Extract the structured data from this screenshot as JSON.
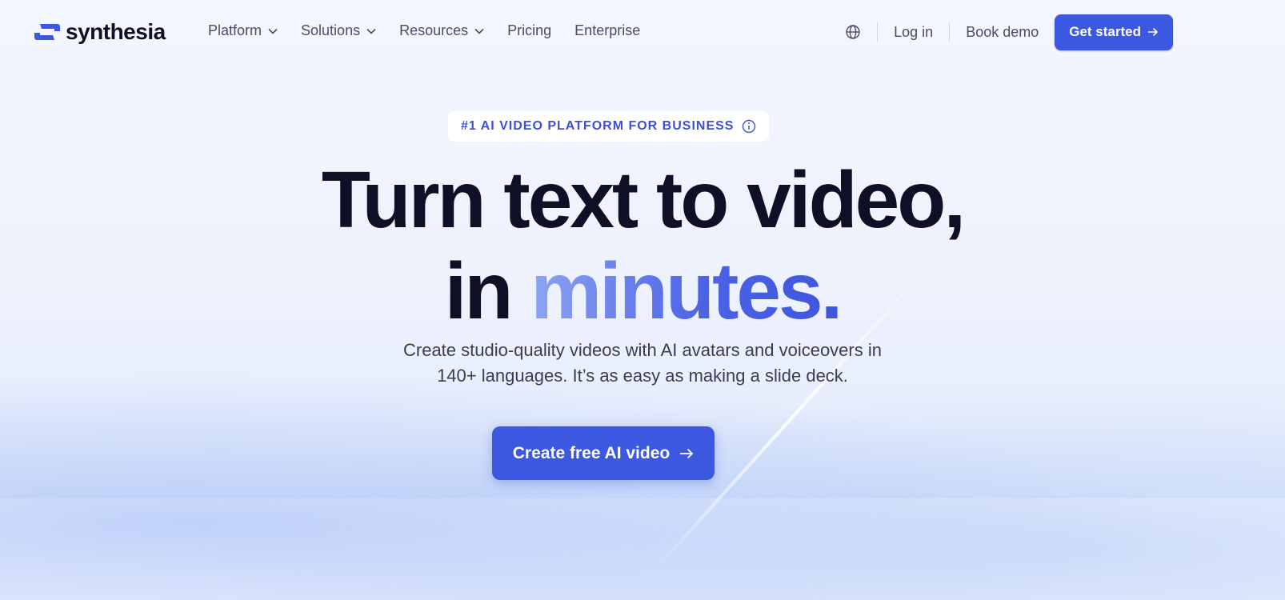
{
  "brand": {
    "name": "synthesia",
    "color": "#3d58e0"
  },
  "nav": {
    "items": [
      {
        "label": "Platform",
        "has_dropdown": true
      },
      {
        "label": "Solutions",
        "has_dropdown": true
      },
      {
        "label": "Resources",
        "has_dropdown": true
      },
      {
        "label": "Pricing",
        "has_dropdown": false
      },
      {
        "label": "Enterprise",
        "has_dropdown": false
      }
    ],
    "language_icon": "globe-icon",
    "login": "Log in",
    "book_demo": "Book demo",
    "get_started": "Get started"
  },
  "hero": {
    "badge": "#1 AI VIDEO PLATFORM FOR BUSINESS",
    "badge_icon": "info-icon",
    "headline_line1": "Turn text to video,",
    "headline_line2_prefix": "in ",
    "headline_line2_accent": "minutes.",
    "subtitle_line1": "Create studio-quality videos with AI avatars and voiceovers in",
    "subtitle_line2": "140+ languages. It’s as easy as making a slide deck.",
    "cta": "Create free AI video"
  },
  "colors": {
    "accent": "#3d58e0",
    "text": "#0f1026",
    "muted": "#4a4d62"
  }
}
